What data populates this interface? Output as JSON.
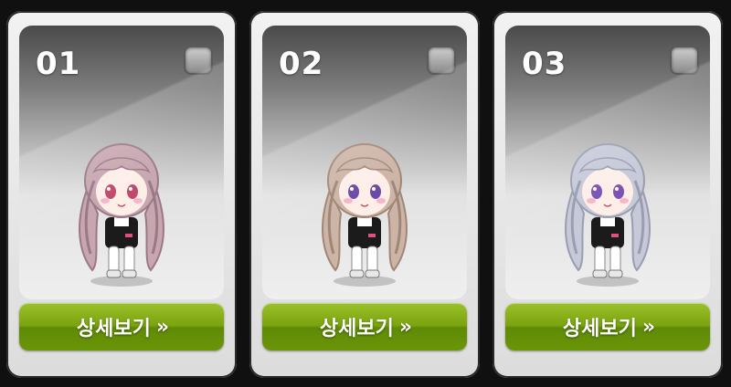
{
  "cards": [
    {
      "number": "01",
      "button_label": "상세보기",
      "button_chevron": "»",
      "hair": "#c7a6b0",
      "hair_dark": "#9a7886",
      "eye": "#c0486a",
      "selected": false
    },
    {
      "number": "02",
      "button_label": "상세보기",
      "button_chevron": "»",
      "hair": "#ccb4a6",
      "hair_dark": "#a08676",
      "eye": "#6a4aa8",
      "selected": false
    },
    {
      "number": "03",
      "button_label": "상세보기",
      "button_chevron": "»",
      "hair": "#c6c9d8",
      "hair_dark": "#9a9db0",
      "eye": "#7a52b4",
      "selected": false
    }
  ],
  "colors": {
    "button_green": "#7aa30f",
    "card_bg": "#eeeeee",
    "page_bg": "#101010"
  }
}
